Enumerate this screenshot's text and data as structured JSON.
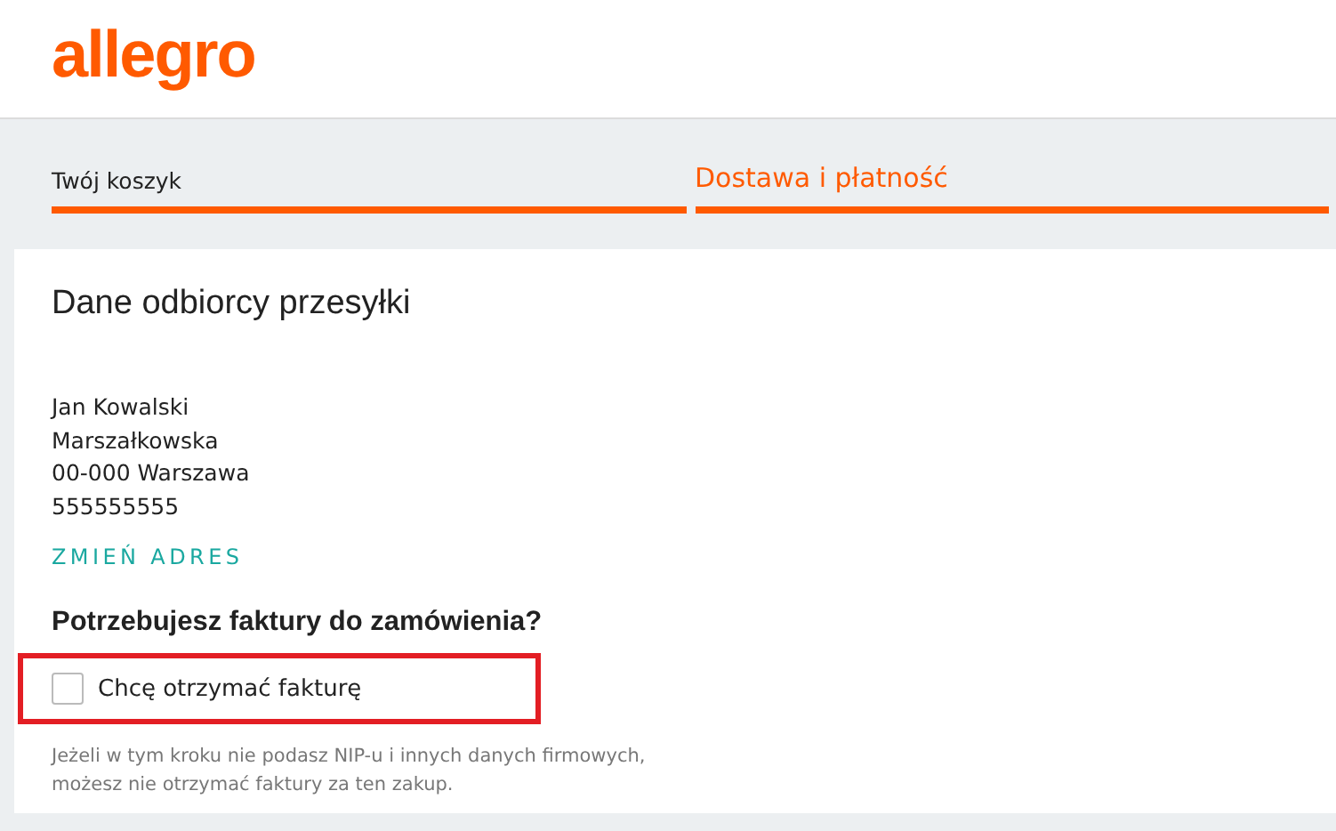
{
  "logo": "allegro",
  "steps": [
    {
      "label": "Twój koszyk",
      "selected": false
    },
    {
      "label": "Dostawa i płatność",
      "selected": true
    }
  ],
  "recipient": {
    "title": "Dane odbiorcy przesyłki",
    "address_lines": [
      "Jan Kowalski",
      "Marszałkowska",
      "00-000 Warszawa",
      "555555555"
    ],
    "change_link": "ZMIEŃ ADRES"
  },
  "invoice": {
    "question": "Potrzebujesz faktury do zamówienia?",
    "highlighted": true,
    "checkbox": {
      "label": "Chcę otrzymać fakturę",
      "checked": false
    },
    "note": "Jeżeli w tym kroku nie podasz NIP-u i innych danych firmowych, możesz nie otrzymać faktury za ten zakup."
  }
}
